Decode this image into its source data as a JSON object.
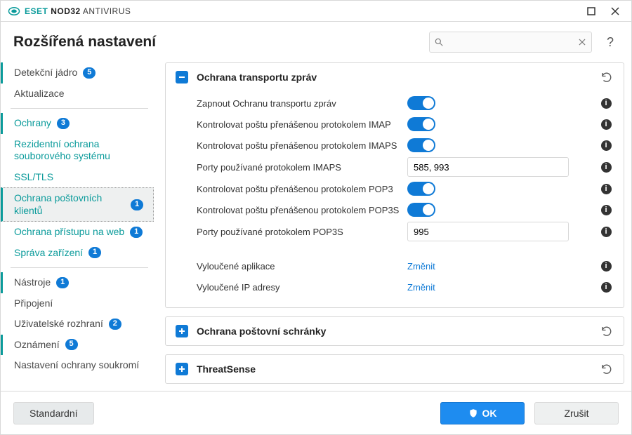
{
  "titlebar": {
    "product_strong": "NOD32",
    "product_rest": " ANTIVIRUS",
    "eset": "ESET"
  },
  "header": {
    "title": "Rozšířená nastavení",
    "help": "?"
  },
  "search": {
    "value": "",
    "placeholder": ""
  },
  "sidebar": {
    "items": [
      {
        "label": "Detekční jádro",
        "badge": "5",
        "accent": false,
        "bar": true
      },
      {
        "label": "Aktualizace",
        "accent": false
      },
      {
        "sep": true
      },
      {
        "label": "Ochrany",
        "badge": "3",
        "accent": true,
        "bar": true
      },
      {
        "label": "Rezidentní ochrana souborového systému",
        "accent": true,
        "sub": true
      },
      {
        "label": "SSL/TLS",
        "accent": true,
        "sub": true
      },
      {
        "label": "Ochrana poštovních klientů",
        "badge": "1",
        "accent": true,
        "sub": true,
        "selected": true
      },
      {
        "label": "Ochrana přístupu na web",
        "badge": "1",
        "accent": true,
        "sub": true
      },
      {
        "label": "Správa zařízení",
        "badge": "1",
        "accent": true,
        "sub": true
      },
      {
        "sep": true
      },
      {
        "label": "Nástroje",
        "badge": "1",
        "bar": true
      },
      {
        "label": "Připojení"
      },
      {
        "label": "Uživatelské rozhraní",
        "badge": "2"
      },
      {
        "label": "Oznámení",
        "badge": "5",
        "bar": true
      },
      {
        "label": "Nastavení ochrany soukromí"
      }
    ]
  },
  "panels": [
    {
      "id": "transport",
      "title": "Ochrana transportu zpráv",
      "expanded": true,
      "rows": [
        {
          "type": "toggle",
          "label": "Zapnout Ochranu transportu zpráv",
          "on": true
        },
        {
          "type": "toggle",
          "label": "Kontrolovat poštu přenášenou protokolem IMAP",
          "on": true
        },
        {
          "type": "toggle",
          "label": "Kontrolovat poštu přenášenou protokolem IMAPS",
          "on": true
        },
        {
          "type": "text",
          "label": "Porty používané protokolem IMAPS",
          "value": "585, 993"
        },
        {
          "type": "toggle",
          "label": "Kontrolovat poštu přenášenou protokolem POP3",
          "on": true
        },
        {
          "type": "toggle",
          "label": "Kontrolovat poštu přenášenou protokolem POP3S",
          "on": true
        },
        {
          "type": "text",
          "label": "Porty používané protokolem POP3S",
          "value": "995"
        },
        {
          "type": "gap"
        },
        {
          "type": "link",
          "label": "Vyloučené aplikace",
          "action": "Změnit"
        },
        {
          "type": "link",
          "label": "Vyloučené IP adresy",
          "action": "Změnit"
        }
      ]
    },
    {
      "id": "mailbox",
      "title": "Ochrana poštovní schránky",
      "expanded": false
    },
    {
      "id": "threatsense",
      "title": "ThreatSense",
      "expanded": false
    }
  ],
  "footer": {
    "default": "Standardní",
    "ok": "OK",
    "cancel": "Zrušit"
  }
}
